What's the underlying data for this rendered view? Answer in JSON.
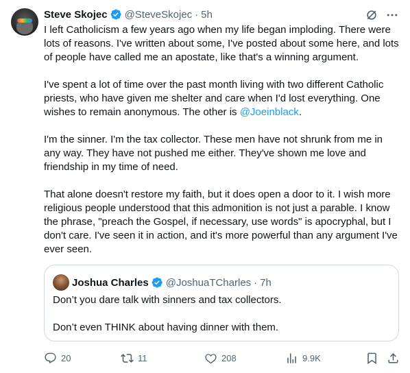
{
  "author": {
    "name": "Steve Skojec",
    "handle": "@SteveSkojec",
    "time": "5h"
  },
  "body": {
    "p1": "I left Catholicism a few years ago when my life began imploding. There were lots of reasons. I've written about some, I've posted about some here, and lots of people have called me an apostate, like that's a winning argument.",
    "p2_before": "I've spent a lot of time over the past month living with two different Catholic priests, who have given me shelter and care when I'd lost everything. One wishes to remain anonymous. The other is ",
    "p2_mention": "@Joeinblack",
    "p2_after": ".",
    "p3": "I'm the sinner. I'm the tax collector. These men have not shrunk from me in any way. They have not pushed me either. They've shown me love and friendship in my time of need.",
    "p4": "That alone doesn't restore my faith, but it does open a door to it. I wish more religious people understood that this admonition is not just a parable. I know the phrase, \"preach the Gospel, if necessary, use words\" is apocryphal, but I don't care. I've seen it in action, and it's more powerful than any argument I've ever seen."
  },
  "quote": {
    "name": "Joshua Charles",
    "handle": "@JoshuaTCharles",
    "time": "7h",
    "line1": "Don’t you dare talk with sinners and tax collectors.",
    "line2": "Don’t even THINK about having dinner with them."
  },
  "actions": {
    "replies": "20",
    "reposts": "11",
    "likes": "208",
    "views": "9.9K"
  },
  "separator": "·",
  "colors": {
    "accent": "#1d9bf0",
    "text": "#0f1419",
    "secondary": "#536471",
    "border": "#cfd9de"
  },
  "icons": [
    "verified-icon",
    "grok-icon",
    "more-icon",
    "reply-icon",
    "repost-icon",
    "like-icon",
    "views-icon",
    "bookmark-icon",
    "share-icon"
  ]
}
